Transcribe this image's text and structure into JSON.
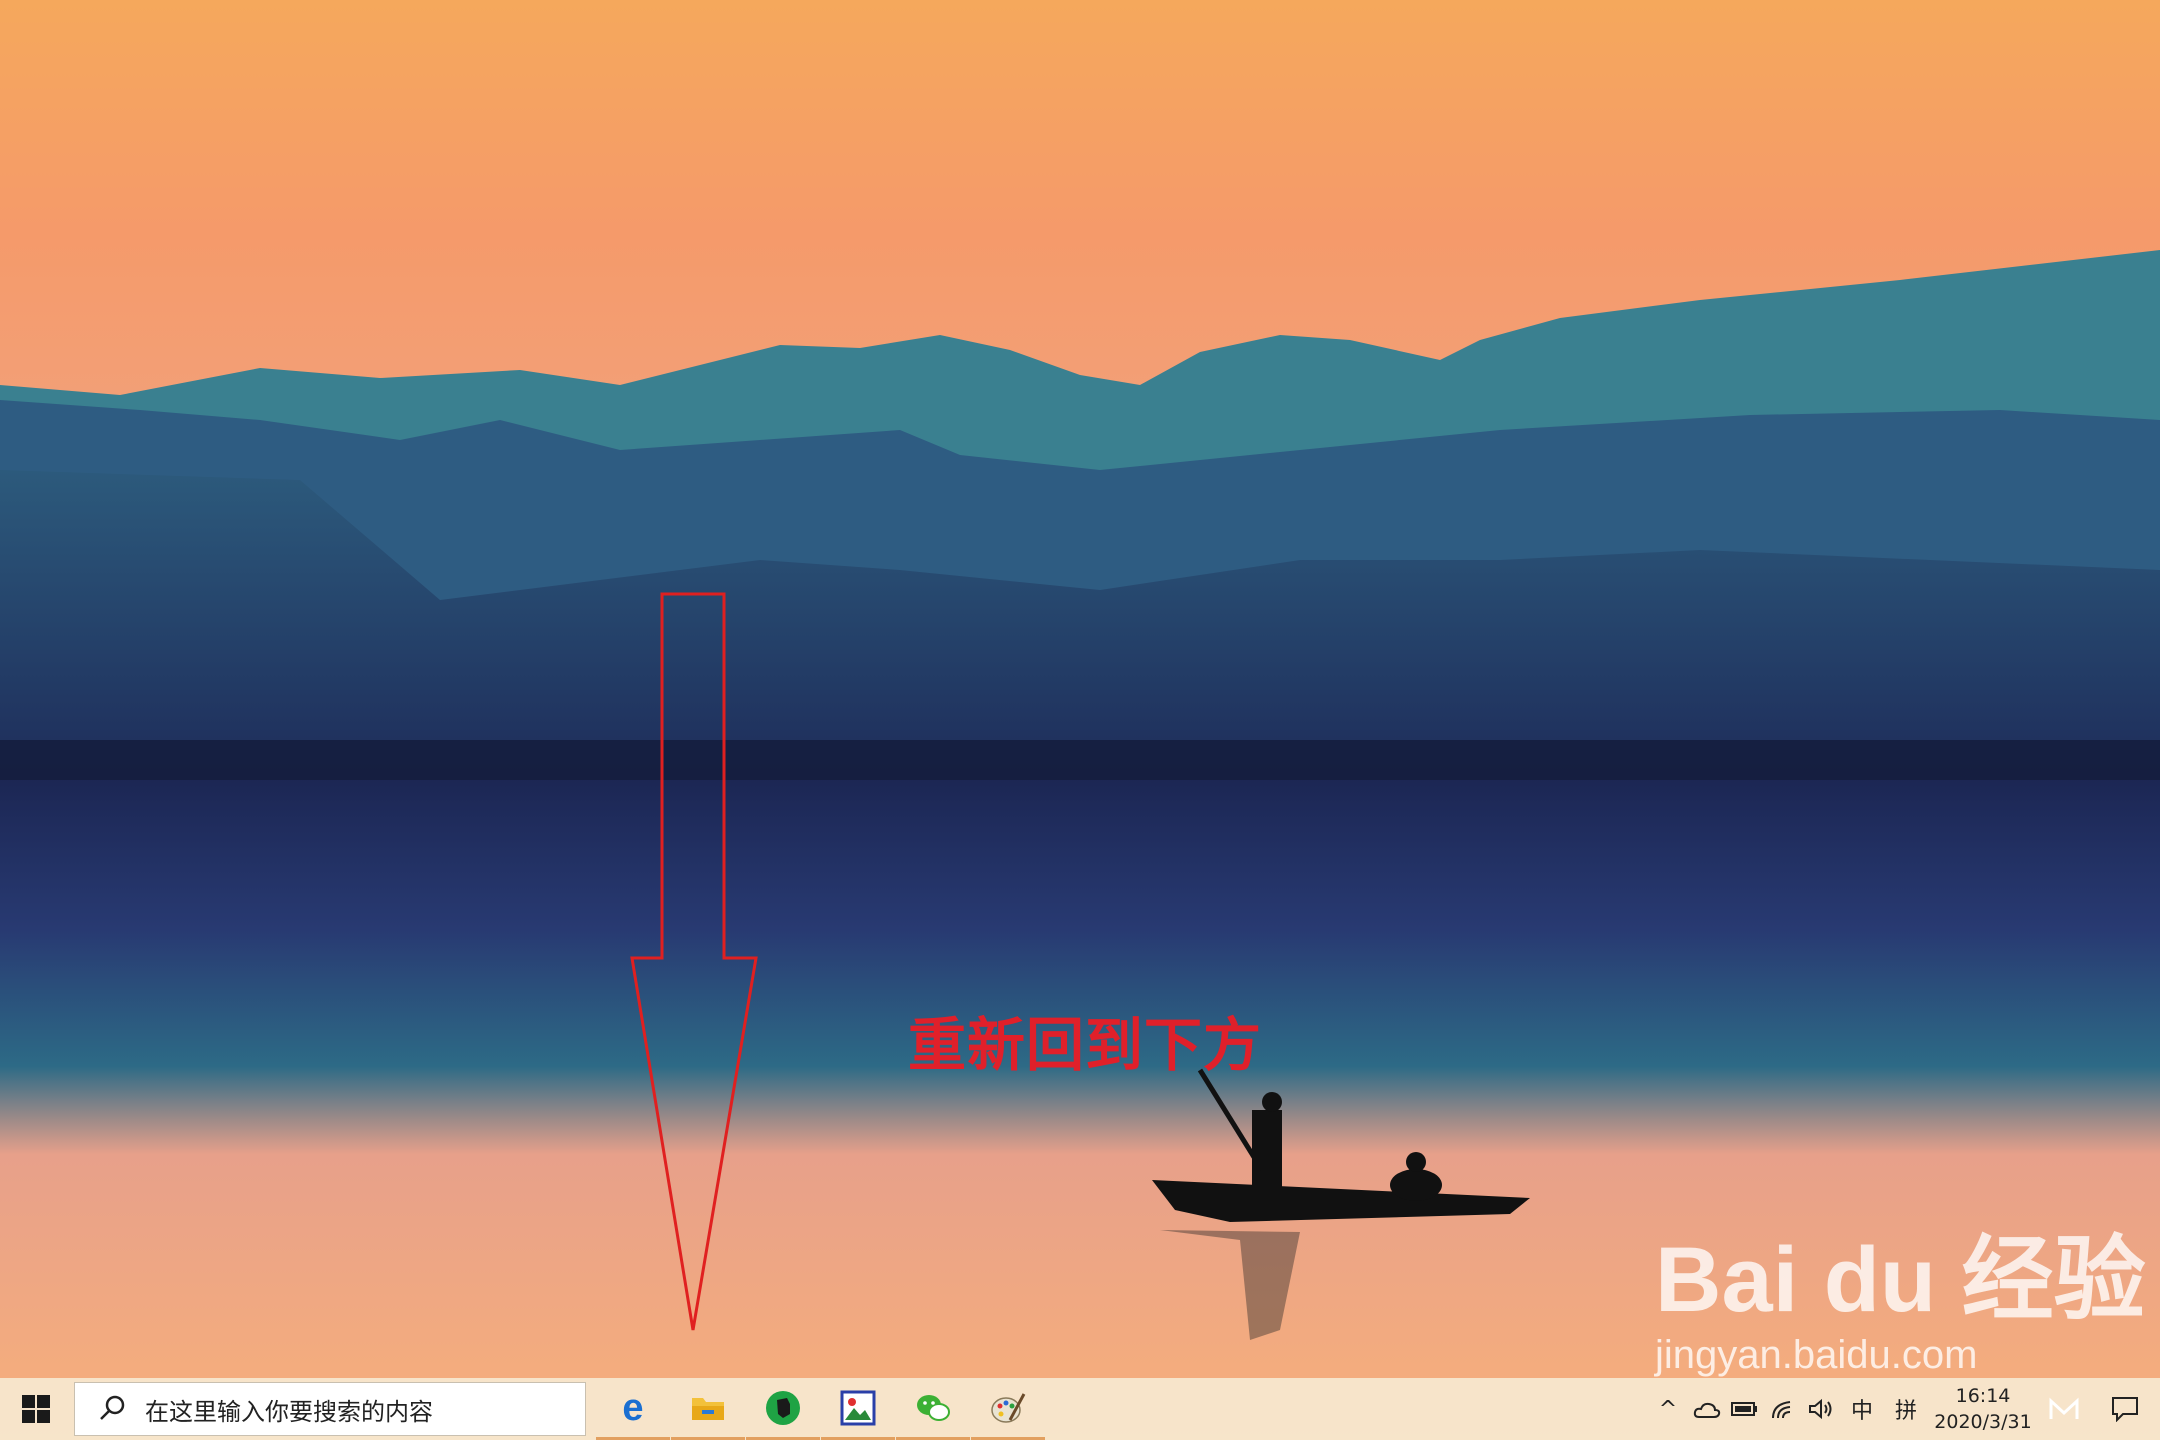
{
  "annotation": {
    "text": "重新回到下方"
  },
  "watermark": {
    "logo": "Bai du 经验",
    "url": "jingyan.baidu.com"
  },
  "taskbar": {
    "search_placeholder": "在这里输入你要搜索的内容",
    "pinned_apps": [
      "edge-icon",
      "file-explorer-icon",
      "evernote-icon",
      "image-viewer-icon",
      "wechat-icon",
      "paint-icon"
    ],
    "tray": {
      "chevron": "^",
      "input_mode": "中",
      "ime": "拼",
      "time": "16:14",
      "date": "2020/3/31"
    }
  },
  "colors": {
    "annotation": "#e0202a",
    "taskbar": "#f6e8d0",
    "arrow": "#e02020"
  }
}
